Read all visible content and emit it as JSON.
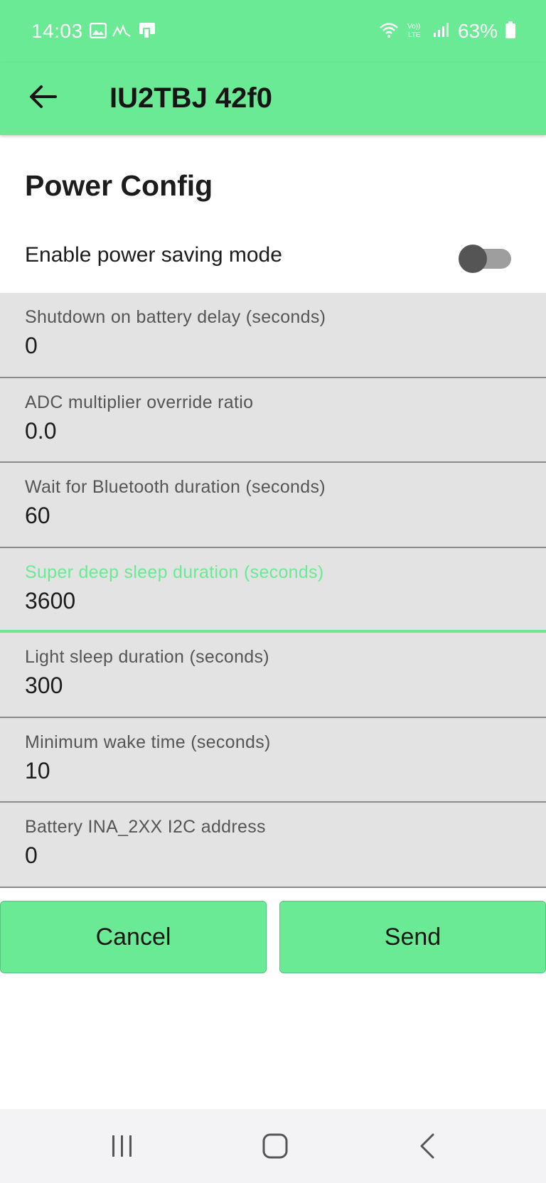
{
  "status_bar": {
    "time": "14:03",
    "battery_percent": "63%",
    "left_icons": [
      "gallery-icon",
      "signal-wave-icon",
      "device-icon"
    ],
    "right_icons": [
      "wifi-icon",
      "volte-icon",
      "cell-signal-icon",
      "battery-icon"
    ]
  },
  "app_bar": {
    "title": "IU2TBJ 42f0",
    "back_icon": "arrow-left-icon"
  },
  "section": {
    "title": "Power Config"
  },
  "power_saving": {
    "label": "Enable power saving mode",
    "enabled": false
  },
  "fields": [
    {
      "label": "Shutdown on battery delay (seconds)",
      "value": "0"
    },
    {
      "label": "ADC multiplier override ratio",
      "value": "0.0"
    },
    {
      "label": "Wait for Bluetooth duration (seconds)",
      "value": "60"
    },
    {
      "label": "Super deep sleep duration (seconds)",
      "value": "3600",
      "focused": true
    },
    {
      "label": "Light sleep duration (seconds)",
      "value": "300"
    },
    {
      "label": "Minimum wake time (seconds)",
      "value": "10"
    },
    {
      "label": "Battery INA_2XX I2C address",
      "value": "0"
    }
  ],
  "actions": {
    "cancel_label": "Cancel",
    "send_label": "Send"
  },
  "nav_bar": {
    "items": [
      "recents-icon",
      "home-icon",
      "back-chevron-icon"
    ]
  },
  "colors": {
    "accent": "#6aea94",
    "field_bg": "#e3e3e3"
  }
}
